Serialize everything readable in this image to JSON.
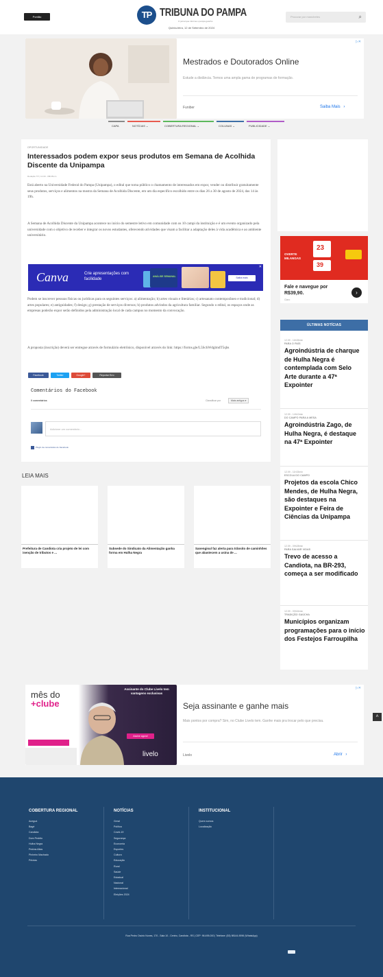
{
  "header": {
    "pontoon_label": "Pontão",
    "logo_mark": "TP",
    "logo_name": "TRIBUNA DO PAMPA",
    "logo_tagline": "O jornal que informa o pampa gaúcho",
    "date": "Quinta-feira, 12 de Setembro de 2024",
    "search_placeholder": "Procurar por manchetes",
    "search_icon": "search-icon"
  },
  "top_ad": {
    "title": "Mestrados e Doutorados Online",
    "description": "Estude a distância. Temos uma ampla gama de programas de formação.",
    "brand": "Funiber",
    "cta": "Saiba Mais",
    "cta_icon": "chevron-right-icon",
    "close_icon": "ad-choices-icon"
  },
  "nav": {
    "items": [
      {
        "label": "CAPA",
        "color": "#8a8a8a"
      },
      {
        "label": "NOTÍCIAS",
        "color": "#e85a4f"
      },
      {
        "label": "COBERTURA REGIONAL",
        "color": "#5cb85c"
      },
      {
        "label": "COLUNAS",
        "color": "#3d6ea6"
      },
      {
        "label": "PUBLICIDADE",
        "color": "#b05cc7"
      }
    ],
    "dropdown_icon": "chevron-down-icon"
  },
  "article": {
    "kicker": "OPORTUNIDADE",
    "title": "Interessados podem expor seus produtos em Semana de Acolhida Discente da Unipampa",
    "byline": "Redação TP  |  12.09 - 08h45min",
    "paragraphs": [
      "Está aberto na Universidade Federal do Pampa (Unipampa), o edital que torna público o chamamento de interessados em expor, vender ou distribuir gratuitamente seus produtos, serviços e alimentos na mostra da Semana de Acolhida Discente, em um dia específico escolhido entre os dias 26 a 30 de agosto de 2024, das 14 às 19h.",
      "A Semana de Acolhida Discente da Unipampa acontece no início do semestre letivo em comunidade com os 10 campi da instituição e é um evento organizado pela universidade com o objetivo de receber e integrar os novos estudantes, oferecendo atividades que visam a facilitar a adaptação deles à vida acadêmica e ao ambiente universitário.",
      "Podem se inscrever pessoas físicas ou jurídicas para os seguintes serviços: a) alimentação; b) artes visuais e literárias; c) artesanato contemporâneo e tradicional; d) artes populares; e) antiguidades; f) design; g) prestação de serviços diversos; h) produtos advindos da agricultura familiar. Segundo o edital, os espaços onde as empresas poderão expor serão definidos pela administração local de cada campus no momento da convocação.",
      "A proposta (inscrição) deverá ser entregue através de formulário eletrônico, disponível através do link: https://forms.gle/L5SchWdglmdT5qbs"
    ],
    "share": [
      {
        "label": "Facebook",
        "color": "#3b5998"
      },
      {
        "label": "Twitter",
        "color": "#1da1f2"
      },
      {
        "label": "Google+",
        "color": "#dd4b39"
      },
      {
        "label": "Reportar Erro",
        "color": "#555555"
      }
    ],
    "comments_title": "Comentários do Facebook",
    "comments_count": "0 comentários",
    "sort_label": "Classificar por",
    "sort_value": "Mais antigos",
    "comment_placeholder": "Adicione um comentário...",
    "plugin_label": "Plugin de comentários do Facebook"
  },
  "canva_ad": {
    "brand": "Canva",
    "text": "Crie apresentações com facilidade",
    "cta": "Saiba mais",
    "tile_text": "ANÁLISE SEMANAL"
  },
  "leia_mais": {
    "title": "LEIA MAIS",
    "items": [
      {
        "title": "Prefeitura de Candiota cria projeto de lei com isenção de tributos e ..."
      },
      {
        "title": "Subsede do Sindicato da Alimentação ganha forma em Hulha Negra"
      },
      {
        "title": "Sanengisul faz alerta para trânsito de caminhões que abastecem a usina de ..."
      }
    ]
  },
  "side_ad": {
    "top_text": "OVERTE MILANGAS",
    "price1": "23",
    "price2": "39",
    "caption": "Fale e navegue por R$39,90.",
    "brand": "Claro",
    "arrow_icon": "chevron-right-icon"
  },
  "latest": {
    "heading": "ÚLTIMAS NOTÍCIAS",
    "items": [
      {
        "time": "12.09 - 16h35min",
        "category": "PARA O PAÍS",
        "title": "Agroindústria de charque de Hulha Negra é contemplada com Selo Arte durante a 47ª Expointer"
      },
      {
        "time": "12.09 - 14h10min",
        "category": "DO CAMPO PARA A MESA",
        "title": "Agroindústria Zago, de Hulha Negra, é destaque na 47ª Expointer"
      },
      {
        "time": "12.09 - 11h33min",
        "category": "ESCOLA DO CAMPO",
        "title": "Projetos da escola Chico Mendes, de Hulha Negra, são destaques na Expointer e Feira de Ciências da Unipampa"
      },
      {
        "time": "12.09 - 09h28min",
        "category": "PARA SALVAR VIDAS",
        "title": "Trevo de acesso a Candiota, na BR-293, começa a ser modificado"
      },
      {
        "time": "12.09 - 09h04min",
        "category": "TRADIÇÃO GAÚCHA",
        "title": "Municípios organizam programações para o início dos Festejos Farroupilha"
      }
    ]
  },
  "bottom_ad": {
    "brand_line1": "mês do",
    "brand_line2": "+clube",
    "banner_text": "Assinante do Clube Livelo tem vantagens exclusivas",
    "badge": "Assine agora!",
    "logo": "livelo",
    "title": "Seja assinante e ganhe mais",
    "description": "Mais pontos por compra? Sim, no Clube Livelo tem. Ganhe mais pra trocar pelo que precisa.",
    "advertiser": "Livelo",
    "cta": "Abrir",
    "close_icon": "ad-choices-icon"
  },
  "footer": {
    "columns": [
      {
        "heading": "COBERTURA REGIONAL",
        "links": [
          "Aceguá",
          "Bagé",
          "Candiota",
          "Dom Pedrito",
          "Hulha Negra",
          "Pedras Altas",
          "Pinheiro Machado",
          "Pelotas"
        ]
      },
      {
        "heading": "NOTÍCIAS",
        "links": [
          "Geral",
          "Política",
          "Covid-19",
          "Segurança",
          "Economia",
          "Esportes",
          "Cultura",
          "Educação",
          "Rural",
          "Saúde",
          "Estadual",
          "Nacional",
          "Internacional",
          "Eleições 2024"
        ]
      },
      {
        "heading": "INSTITUCIONAL",
        "links": [
          "Quem somos",
          "Localização"
        ]
      }
    ],
    "address": "Rua Pedro Osório Nunes, 170 - Sala 10 - Centro, Candiota - RS | CEP: 96.495-000 | Telefone: (53) 98144-9096 (WhatsApp)"
  },
  "back_to_top_icon": "arrow-up-icon"
}
